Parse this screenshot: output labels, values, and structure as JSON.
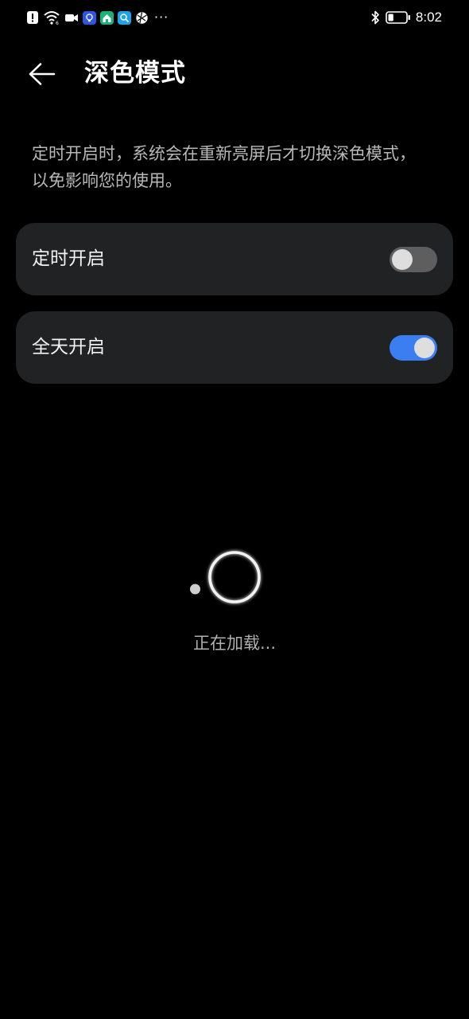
{
  "status_bar": {
    "time": "8:02",
    "more": "···",
    "icons": [
      "notification-icon",
      "wifi-icon",
      "video-icon",
      "bulb-app-icon",
      "home-app-icon",
      "search-app-icon",
      "sports-app-icon",
      "bluetooth-icon",
      "battery-icon"
    ],
    "battery_level": 0.3
  },
  "header": {
    "back_icon": "arrow-left-icon",
    "title": "深色模式"
  },
  "description": "定时开启时，系统会在重新亮屏后才切换深色模式，以免影响您的使用。",
  "options": [
    {
      "label": "定时开启",
      "enabled": false
    },
    {
      "label": "全天开启",
      "enabled": true
    }
  ],
  "loading": {
    "text": "正在加载..."
  },
  "colors": {
    "background": "#000000",
    "card": "#212224",
    "switch_on": "#3a7ef2",
    "switch_off": "#5e5e5e",
    "secondary_text": "#b8b8b8"
  }
}
